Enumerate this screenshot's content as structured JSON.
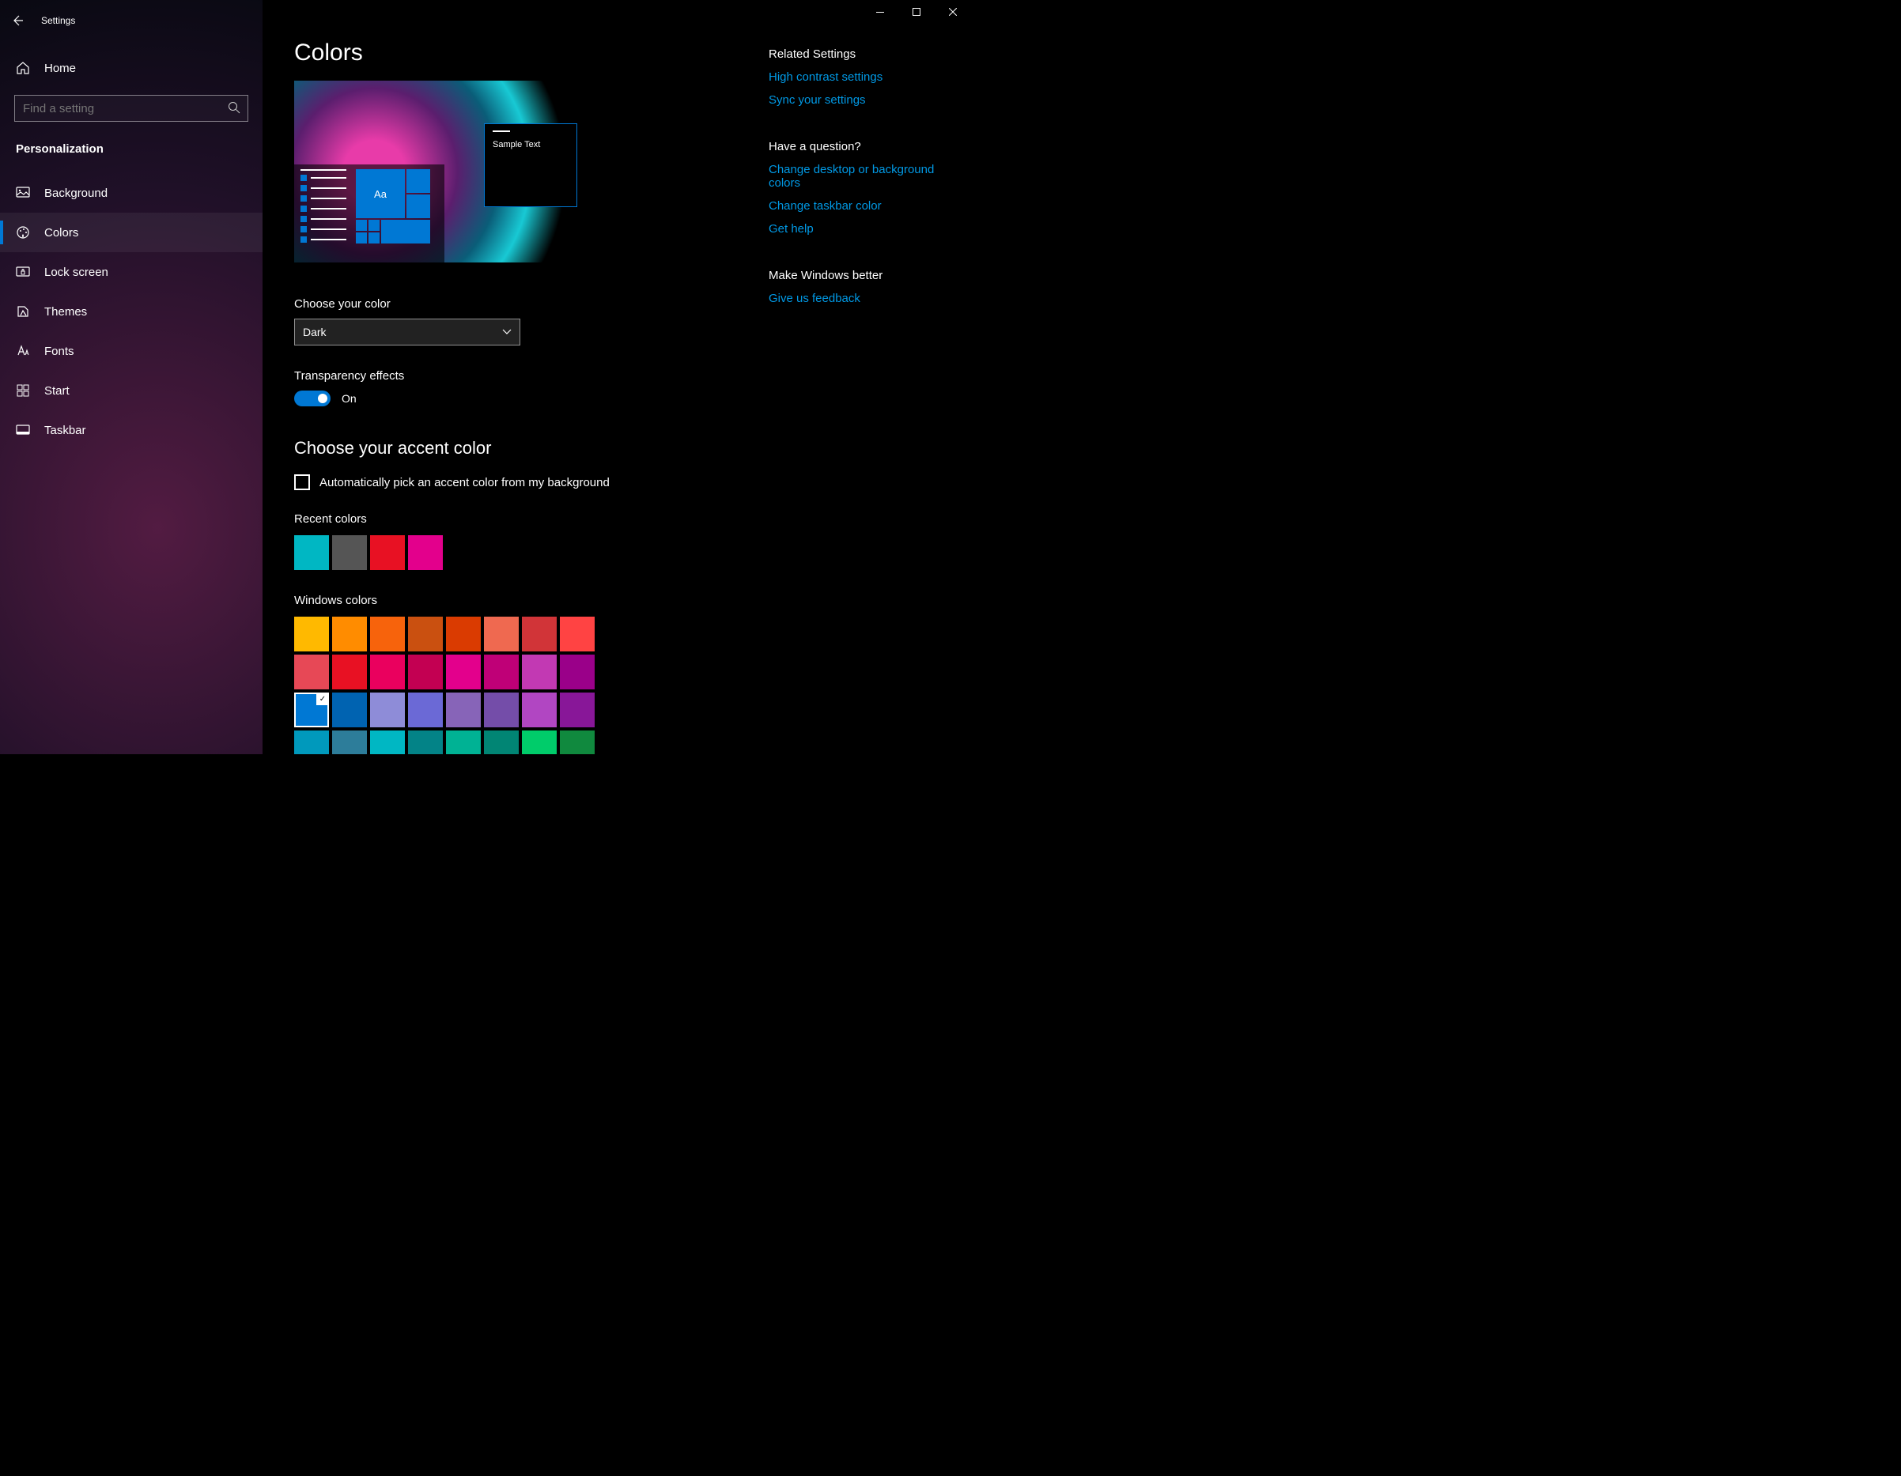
{
  "app_title": "Settings",
  "home_label": "Home",
  "search_placeholder": "Find a setting",
  "section_label": "Personalization",
  "nav": [
    {
      "label": "Background",
      "id": "background"
    },
    {
      "label": "Colors",
      "id": "colors",
      "active": true
    },
    {
      "label": "Lock screen",
      "id": "lock-screen"
    },
    {
      "label": "Themes",
      "id": "themes"
    },
    {
      "label": "Fonts",
      "id": "fonts"
    },
    {
      "label": "Start",
      "id": "start"
    },
    {
      "label": "Taskbar",
      "id": "taskbar"
    }
  ],
  "page_title": "Colors",
  "preview_sample_text": "Sample Text",
  "preview_tile_text": "Aa",
  "choose_color_label": "Choose your color",
  "choose_color_value": "Dark",
  "transparency_label": "Transparency effects",
  "transparency_state": "On",
  "accent_heading": "Choose your accent color",
  "auto_pick_label": "Automatically pick an accent color from my background",
  "recent_colors_label": "Recent colors",
  "recent_colors": [
    "#00b7c3",
    "#555555",
    "#e81123",
    "#e3008c"
  ],
  "windows_colors_label": "Windows colors",
  "windows_colors": [
    "#ffb900",
    "#ff8c00",
    "#f7630c",
    "#ca5010",
    "#da3b01",
    "#ef6950",
    "#d13438",
    "#ff4343",
    "#e74856",
    "#e81123",
    "#ea005e",
    "#c30052",
    "#e3008c",
    "#bf0077",
    "#c239b3",
    "#9a0089",
    "#0078d4",
    "#0063b1",
    "#8e8cd8",
    "#6b69d6",
    "#8764b8",
    "#744da9",
    "#b146c2",
    "#881798",
    "#0099bc",
    "#2d7d9a",
    "#00b7c3",
    "#038387",
    "#00b294",
    "#018574",
    "#00cc6a",
    "#10893e"
  ],
  "selected_color_index": 16,
  "related_heading": "Related Settings",
  "related_links": [
    "High contrast settings",
    "Sync your settings"
  ],
  "question_heading": "Have a question?",
  "question_links": [
    "Change desktop or background colors",
    "Change taskbar color",
    "Get help"
  ],
  "better_heading": "Make Windows better",
  "better_links": [
    "Give us feedback"
  ]
}
